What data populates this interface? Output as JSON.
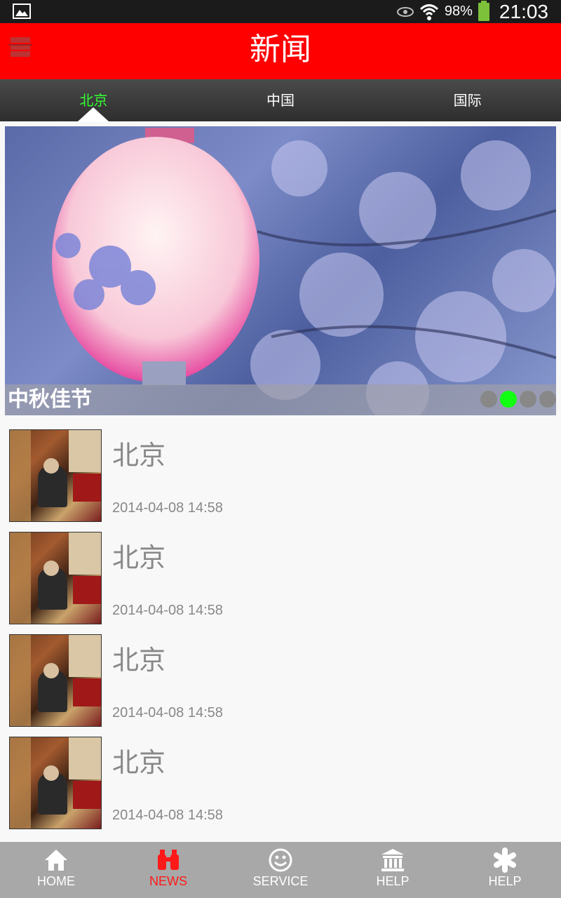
{
  "status_bar": {
    "battery_percent": "98%",
    "time": "21:03",
    "icons": [
      "picture-icon",
      "eye-icon",
      "wifi-icon",
      "battery-icon"
    ]
  },
  "header": {
    "title": "新闻",
    "menu_icon": "menu-icon"
  },
  "tabs": [
    {
      "label": "北京",
      "active": true
    },
    {
      "label": "中国",
      "active": false
    },
    {
      "label": "国际",
      "active": false
    }
  ],
  "banner": {
    "caption": "中秋佳节",
    "pager_count": 4,
    "pager_active_index": 1
  },
  "news": [
    {
      "title": "北京",
      "time": "2014-04-08 14:58"
    },
    {
      "title": "北京",
      "time": "2014-04-08 14:58"
    },
    {
      "title": "北京",
      "time": "2014-04-08 14:58"
    },
    {
      "title": "北京",
      "time": "2014-04-08 14:58"
    }
  ],
  "bottom_nav": [
    {
      "label": "HOME",
      "icon": "home-icon",
      "active": false
    },
    {
      "label": "NEWS",
      "icon": "binoculars-icon",
      "active": true
    },
    {
      "label": "SERVICE",
      "icon": "smiley-icon",
      "active": false
    },
    {
      "label": "HELP",
      "icon": "bank-icon",
      "active": false
    },
    {
      "label": "HELP",
      "icon": "asterisk-icon",
      "active": false
    }
  ],
  "colors": {
    "header_bg": "#ff0000",
    "active_tab": "#33ff33",
    "active_nav": "#ff1a1a",
    "nav_bg": "#a8a8a8"
  }
}
